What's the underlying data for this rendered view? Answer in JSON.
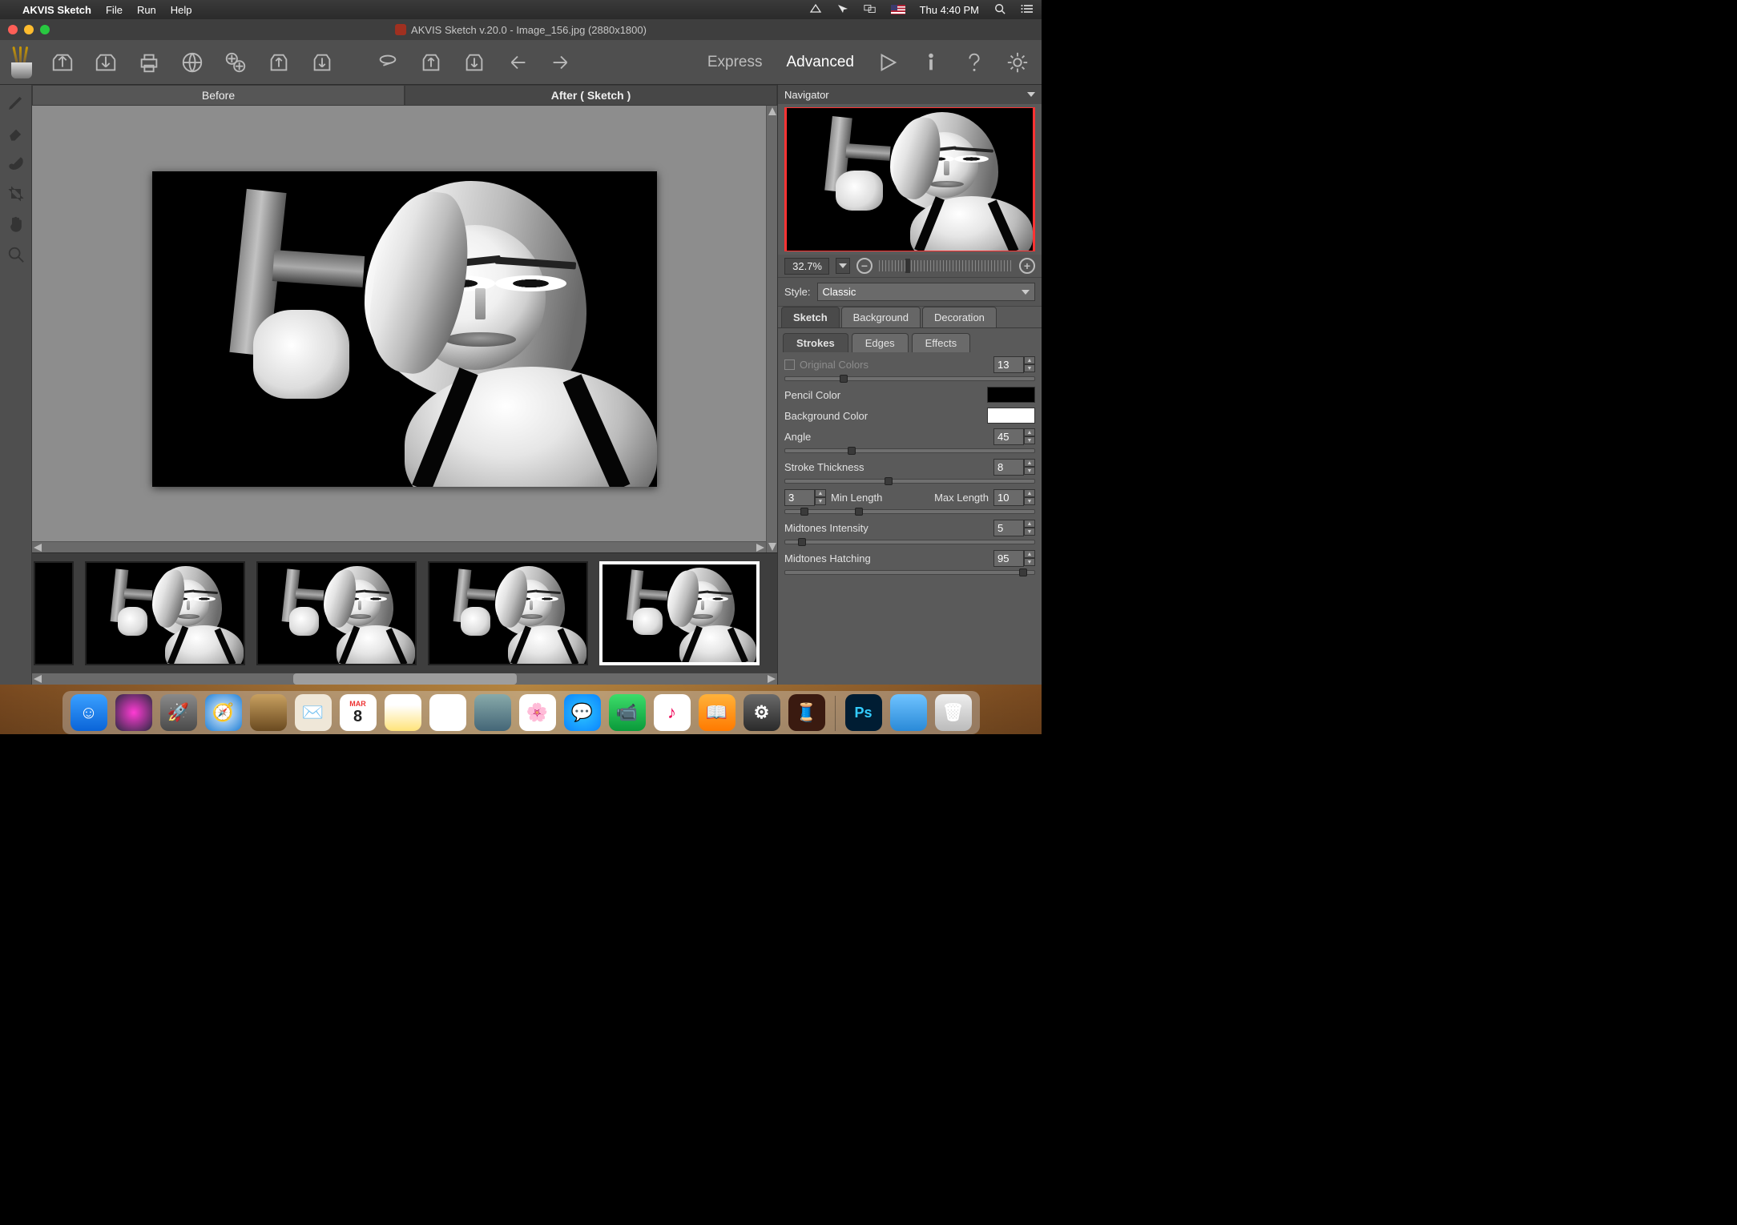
{
  "menubar": {
    "app": "AKVIS Sketch",
    "items": [
      "File",
      "Run",
      "Help"
    ],
    "clock": "Thu 4:40 PM"
  },
  "window": {
    "title": "AKVIS Sketch v.20.0 - Image_156.jpg (2880x1800)"
  },
  "modes": {
    "express": "Express",
    "advanced": "Advanced",
    "active": "advanced"
  },
  "canvas_tabs": {
    "before": "Before",
    "after": "After ( Sketch )",
    "active": "after"
  },
  "navigator": {
    "title": "Navigator",
    "zoom": "32.7%"
  },
  "style": {
    "label": "Style:",
    "value": "Classic"
  },
  "panel_tabs": {
    "items": [
      "Sketch",
      "Background",
      "Decoration"
    ],
    "active": 0
  },
  "sub_tabs": {
    "items": [
      "Strokes",
      "Edges",
      "Effects"
    ],
    "active": 0
  },
  "params": {
    "original_colors": {
      "label": "Original Colors",
      "value": "13",
      "checked": false
    },
    "pencil_color": {
      "label": "Pencil Color",
      "hex": "#000000"
    },
    "background_color": {
      "label": "Background Color",
      "hex": "#ffffff"
    },
    "angle": {
      "label": "Angle",
      "value": "45"
    },
    "stroke_thickness": {
      "label": "Stroke Thickness",
      "value": "8"
    },
    "min_length": {
      "label": "Min Length",
      "value": "3"
    },
    "max_length": {
      "label": "Max Length",
      "value": "10"
    },
    "midtones_intensity": {
      "label": "Midtones Intensity",
      "value": "5"
    },
    "midtones_hatching": {
      "label": "Midtones Hatching",
      "value": "95"
    }
  },
  "dock": {
    "calendar": {
      "month": "MAR",
      "day": "8"
    }
  }
}
